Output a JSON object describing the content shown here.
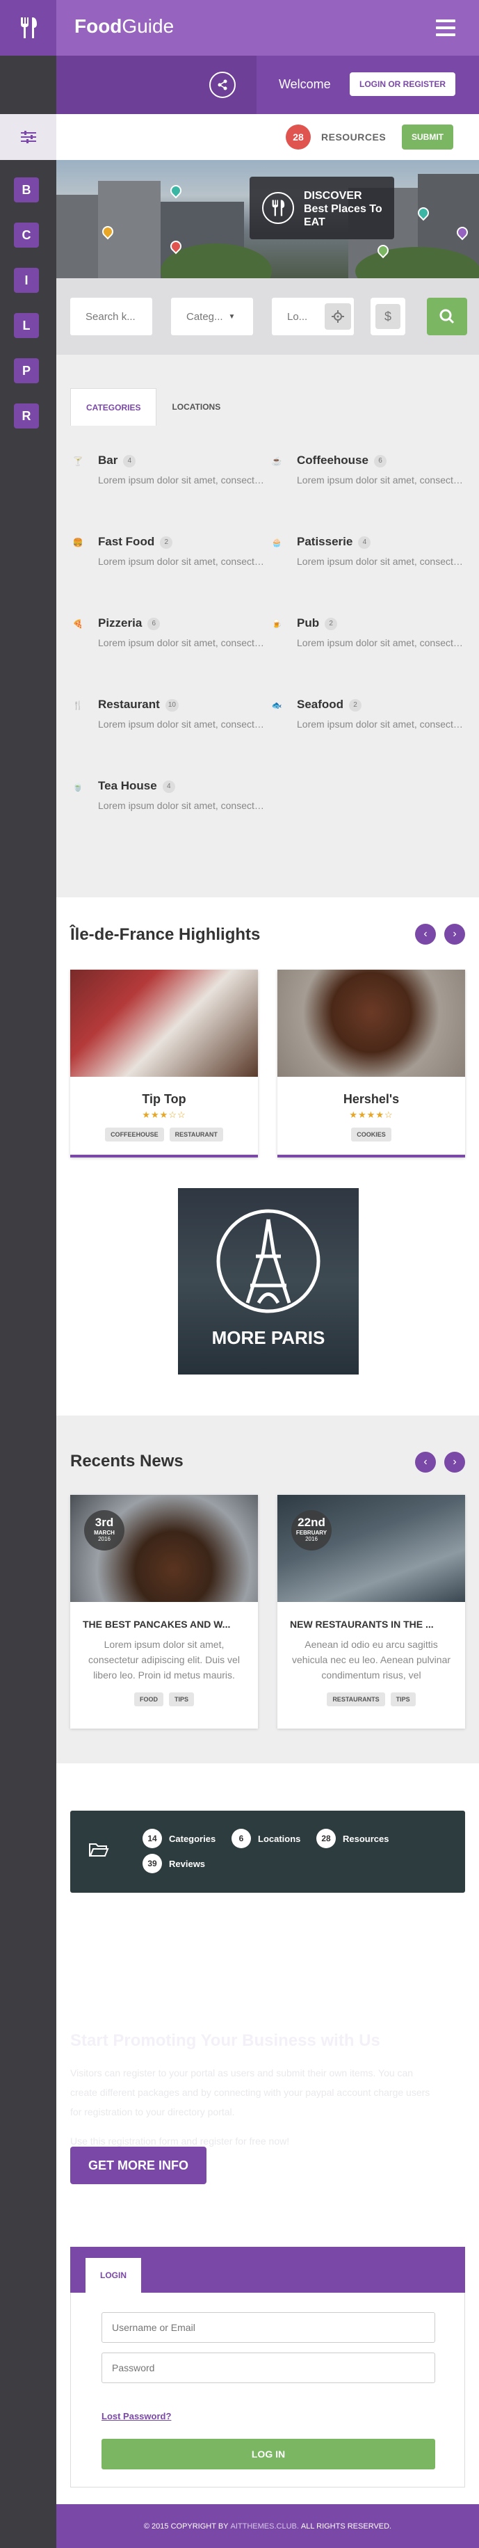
{
  "brand": {
    "bold": "Food",
    "rest": "Guide"
  },
  "header": {
    "welcome": "Welcome",
    "login_register": "LOGIN OR REGISTER"
  },
  "status": {
    "count": "28",
    "resources": "RESOURCES",
    "submit": "SUBMIT"
  },
  "rail": {
    "letters": [
      "B",
      "C",
      "I",
      "L",
      "P",
      "R"
    ]
  },
  "hero": {
    "discover": "DISCOVER Best Places To EAT"
  },
  "search": {
    "keyword": "Search k...",
    "category": "Categ...",
    "location": "Lo...",
    "price_symbol": "$"
  },
  "tabs": {
    "categories": "CATEGORIES",
    "locations": "LOCATIONS"
  },
  "categories": [
    {
      "name": "Bar",
      "count": "4",
      "desc": "Lorem ipsum dolor sit amet, consectetur adipisicing elit, sed do...",
      "icon": "cocktail-icon",
      "color": "#3bb6a5"
    },
    {
      "name": "Coffeehouse",
      "count": "6",
      "desc": "Lorem ipsum dolor sit amet, consectetur adipisicing elit, sed do...",
      "icon": "coffee-icon",
      "color": "#e0544f"
    },
    {
      "name": "Fast Food",
      "count": "2",
      "desc": "Lorem ipsum dolor sit amet, consectetur adipisicing elit, sed do...",
      "icon": "burger-icon",
      "color": "#e7a626"
    },
    {
      "name": "Patisserie",
      "count": "4",
      "desc": "Lorem ipsum dolor sit amet, consectetur adipisicing elit, sed do...",
      "icon": "cake-icon",
      "color": "#c764c4"
    },
    {
      "name": "Pizzeria",
      "count": "6",
      "desc": "Lorem ipsum dolor sit amet, consectetur adipisicing elit, sed do...",
      "icon": "pizza-icon",
      "color": "#e0544f"
    },
    {
      "name": "Pub",
      "count": "2",
      "desc": "Lorem ipsum dolor sit amet, consectetur adipisicing elit, sed do...",
      "icon": "beer-icon",
      "color": "#e7a626"
    },
    {
      "name": "Restaurant",
      "count": "10",
      "desc": "Lorem ipsum dolor sit amet, consectetur adipisicing elit, sed do...",
      "icon": "cutlery-icon",
      "color": "#7a48a6"
    },
    {
      "name": "Seafood",
      "count": "2",
      "desc": "Lorem ipsum dolor sit amet, consectetur adipisicing elit, sed do...",
      "icon": "fish-icon",
      "color": "#aaaaaa"
    },
    {
      "name": "Tea House",
      "count": "4",
      "desc": "Lorem ipsum dolor sit amet, consectetur adipisicing elit, sed do...",
      "icon": "tea-icon",
      "color": "#7bb663"
    }
  ],
  "highlights": {
    "title": "Île-de-France Highlights",
    "prev": "‹",
    "next": "›",
    "cards": [
      {
        "title": "Tip Top",
        "stars": "★★★☆☆",
        "tags": [
          "COFFEEHOUSE",
          "RESTAURANT"
        ]
      },
      {
        "title": "Hershel's",
        "stars": "★★★★☆",
        "tags": [
          "COOKIES"
        ]
      }
    ],
    "more": "MORE PARIS"
  },
  "news": {
    "title": "Recents News",
    "prev": "‹",
    "next": "›",
    "items": [
      {
        "day": "3rd",
        "month": "MARCH",
        "year": "2016",
        "title": "THE BEST PANCAKES AND W...",
        "text": "Lorem ipsum dolor sit amet, consectetur adipiscing elit. Duis vel libero leo. Proin id metus mauris.",
        "tags": [
          "FOOD",
          "TIPS"
        ]
      },
      {
        "day": "22nd",
        "month": "FEBRUARY",
        "year": "2016",
        "title": "NEW RESTAURANTS IN THE ...",
        "text": "Aenean id odio eu arcu sagittis vehicula nec eu leo. Aenean pulvinar condimentum risus, vel",
        "tags": [
          "RESTAURANTS",
          "TIPS"
        ]
      }
    ]
  },
  "stats": [
    {
      "num": "14",
      "label": "Categories"
    },
    {
      "num": "6",
      "label": "Locations"
    },
    {
      "num": "28",
      "label": "Resources"
    },
    {
      "num": "39",
      "label": "Reviews"
    }
  ],
  "promo": {
    "title": "Start Promoting Your Business with Us",
    "text1": "Visitors can register to your portal as users and submit their own items. You can create different packages and by connecting with your paypal account charge users for registration to your directory portal.",
    "text2": "Use this registration form and register for free now!",
    "button": "GET MORE INFO"
  },
  "login": {
    "tab": "LOGIN",
    "username_placeholder": "Username or Email",
    "password_placeholder": "Password",
    "lost": "Lost Password?",
    "button": "LOG IN"
  },
  "footer": {
    "pre": "© 2015 COPYRIGHT BY",
    "link": "AITTHEMES.CLUB.",
    "post": "ALL RIGHTS RESERVED."
  },
  "colors": {
    "purple": "#7a48a6",
    "green": "#7bb663",
    "red": "#e0544f"
  }
}
